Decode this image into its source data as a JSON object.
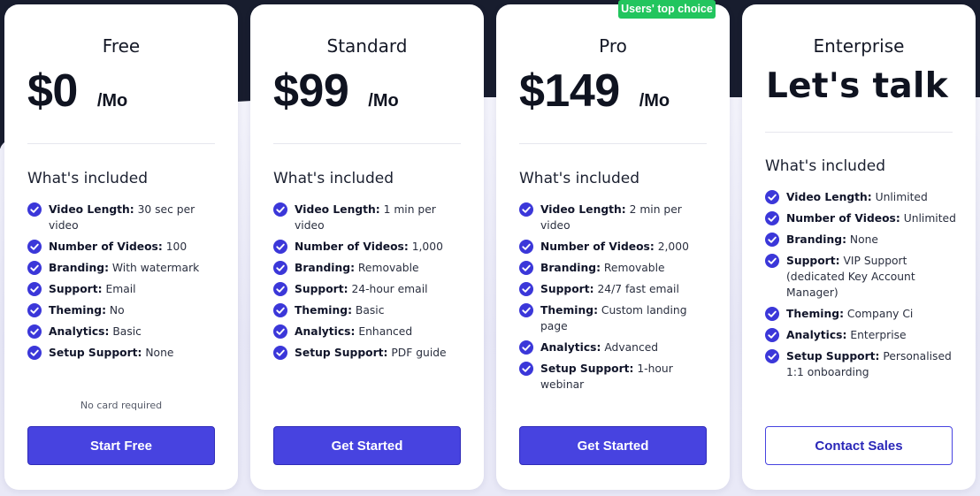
{
  "colors": {
    "accent": "#4743e0",
    "badge": "#22c55e",
    "check": "#3b37d9",
    "dark_band": "#181d2e"
  },
  "badge": {
    "label": "Users' top choice"
  },
  "plans": [
    {
      "name": "Free",
      "price": "$0",
      "unit": "/Mo",
      "included_label": "What's included",
      "features": [
        {
          "label": "Video Length:",
          "value": "30 sec per video"
        },
        {
          "label": "Number of Videos:",
          "value": "100"
        },
        {
          "label": "Branding:",
          "value": "With watermark"
        },
        {
          "label": "Support:",
          "value": "Email"
        },
        {
          "label": "Theming:",
          "value": "No"
        },
        {
          "label": "Analytics:",
          "value": "Basic"
        },
        {
          "label": "Setup Support:",
          "value": "None"
        }
      ],
      "note": "No card required",
      "cta": "Start Free"
    },
    {
      "name": "Standard",
      "price": "$99",
      "unit": "/Mo",
      "included_label": "What's included",
      "features": [
        {
          "label": "Video Length:",
          "value": "1 min per video"
        },
        {
          "label": "Number of Videos:",
          "value": "1,000"
        },
        {
          "label": "Branding:",
          "value": "Removable"
        },
        {
          "label": "Support:",
          "value": "24-hour email"
        },
        {
          "label": "Theming:",
          "value": "Basic"
        },
        {
          "label": "Analytics:",
          "value": "Enhanced"
        },
        {
          "label": "Setup Support:",
          "value": "PDF guide"
        }
      ],
      "cta": "Get Started"
    },
    {
      "name": "Pro",
      "price": "$149",
      "unit": "/Mo",
      "included_label": "What's included",
      "features": [
        {
          "label": "Video Length:",
          "value": "2 min per video"
        },
        {
          "label": "Number of Videos:",
          "value": "2,000"
        },
        {
          "label": "Branding:",
          "value": "Removable"
        },
        {
          "label": "Support:",
          "value": "24/7 fast email"
        },
        {
          "label": "Theming:",
          "value": "Custom landing page"
        },
        {
          "label": "Analytics:",
          "value": "Advanced"
        },
        {
          "label": "Setup Support:",
          "value": "1-hour webinar"
        }
      ],
      "cta": "Get Started"
    },
    {
      "name": "Enterprise",
      "headline": "Let's talk",
      "included_label": "What's included",
      "features": [
        {
          "label": "Video Length:",
          "value": "Unlimited"
        },
        {
          "label": "Number of Videos:",
          "value": "Unlimited"
        },
        {
          "label": "Branding:",
          "value": "None"
        },
        {
          "label": "Support:",
          "value": "VIP Support (dedicated Key Account Manager)"
        },
        {
          "label": "Theming:",
          "value": "Company Ci"
        },
        {
          "label": "Analytics:",
          "value": "Enterprise"
        },
        {
          "label": "Setup Support:",
          "value": "Personalised 1:1 onboarding"
        }
      ],
      "cta": "Contact Sales"
    }
  ]
}
